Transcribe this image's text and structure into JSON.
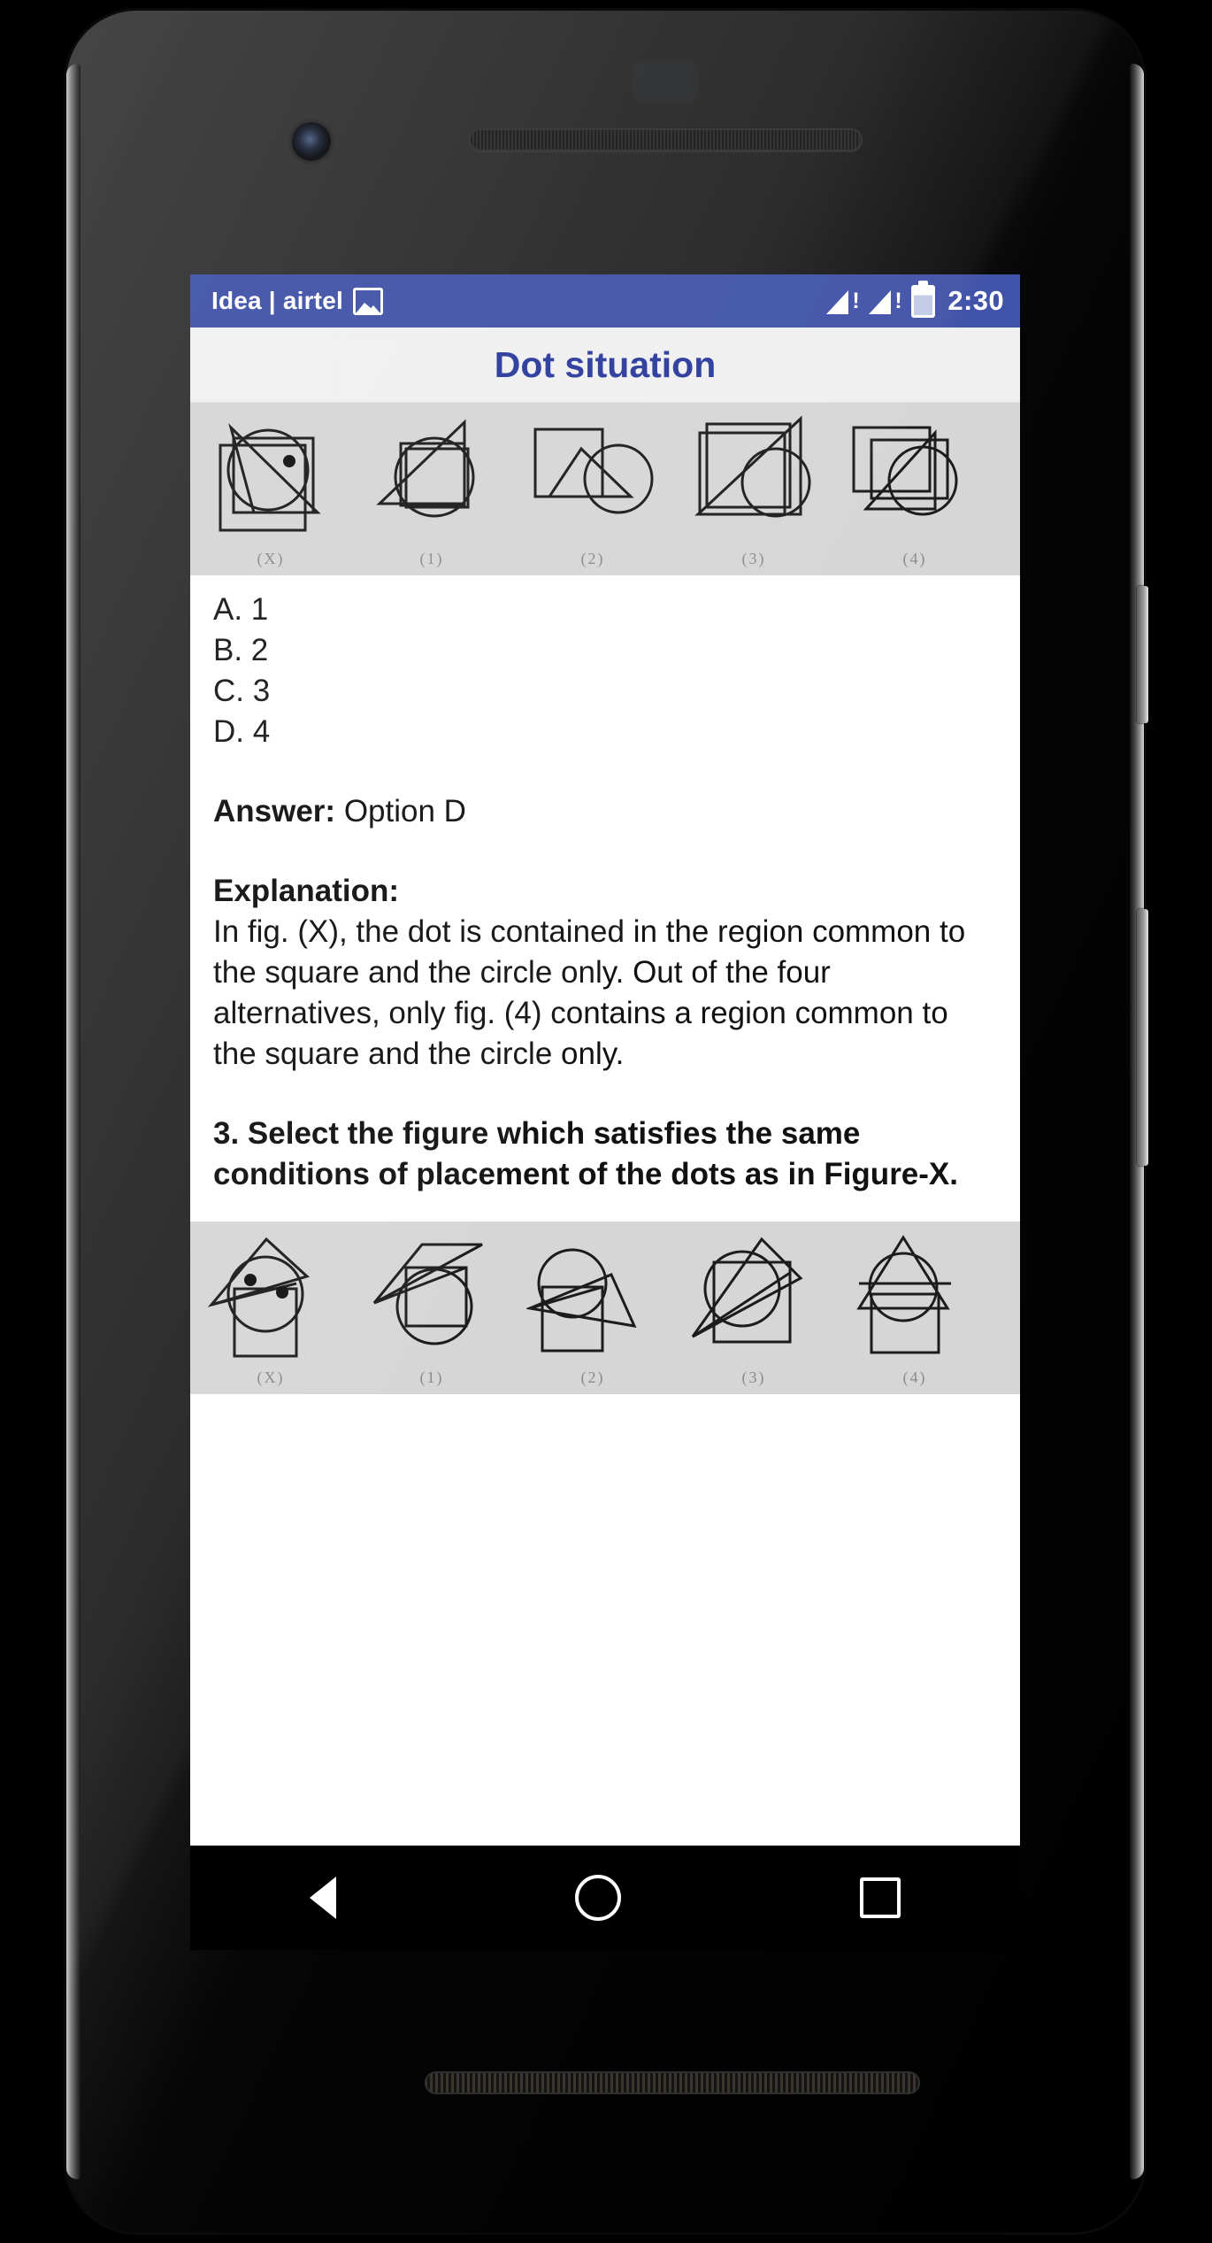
{
  "statusbar": {
    "carrier": "Idea | airtel",
    "image_icon": "image-icon",
    "signal1_icon": "signal-bar-warning-icon",
    "signal2_icon": "signal-bar-warning-icon",
    "battery_icon": "battery-icon",
    "clock": "2:30",
    "bg_color": "#4153a8"
  },
  "titlebar": {
    "title": "Dot situation",
    "title_color": "#2c3b9c"
  },
  "question2": {
    "figure_strip": {
      "labels": [
        "(X)",
        "(1)",
        "(2)",
        "(3)",
        "(4)"
      ],
      "bg_color": "#d6d6d6"
    },
    "options": [
      "A. 1",
      "B. 2",
      "C. 3",
      "D. 4"
    ],
    "answer_label": "Answer:",
    "answer_value": "Option D",
    "explanation_label": "Explanation:",
    "explanation_text": "In fig. (X), the dot is contained in the region common to the square and the circle only. Out of the four alternatives, only fig. (4) contains a region common to the square and the circle only."
  },
  "question3": {
    "text": "3. Select the figure which satisfies the same conditions of placement of the dots as in Figure-X.",
    "figure_strip": {
      "labels": [
        "(X)",
        "(1)",
        "(2)",
        "(3)",
        "(4)"
      ],
      "bg_color": "#d6d6d6"
    }
  },
  "navbar": {
    "back_icon": "back-triangle-icon",
    "home_icon": "home-circle-icon",
    "recents_icon": "recents-square-icon"
  },
  "device": {
    "earpiece": "earpiece-speaker",
    "front_camera": "front-camera",
    "bottom_speaker": "bottom-speaker",
    "power_button": "power-button",
    "volume_button": "volume-rocker"
  }
}
